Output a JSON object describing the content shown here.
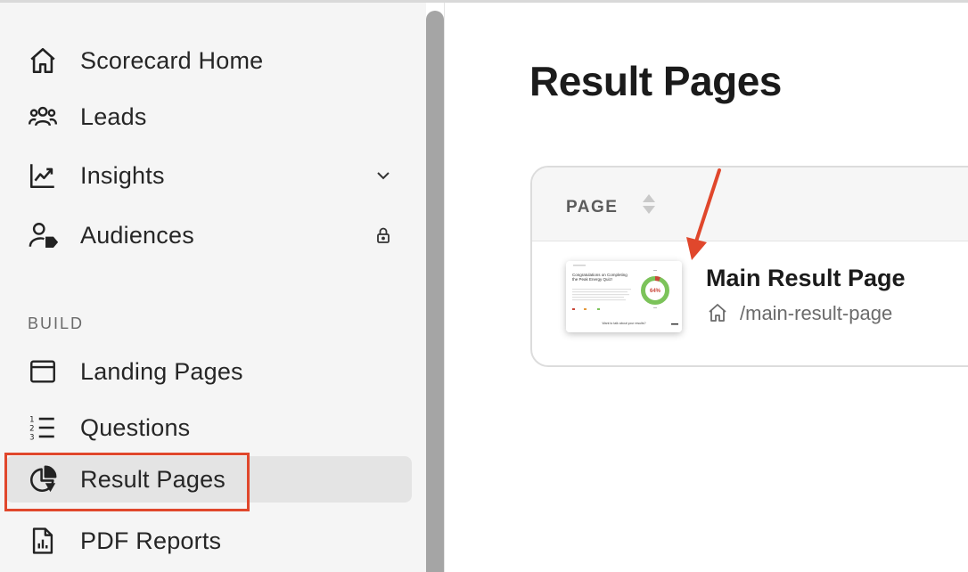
{
  "sidebar": {
    "items": [
      {
        "label": "Scorecard Home",
        "icon": "home-icon"
      },
      {
        "label": "Leads",
        "icon": "users-icon"
      },
      {
        "label": "Insights",
        "icon": "chart-line-icon",
        "trail": "chevron-down-icon"
      },
      {
        "label": "Audiences",
        "icon": "user-tag-icon",
        "trail": "lock-icon"
      }
    ],
    "section_label": "BUILD",
    "build_items": [
      {
        "label": "Landing Pages",
        "icon": "browser-window-icon"
      },
      {
        "label": "Questions",
        "icon": "numbered-list-icon"
      },
      {
        "label": "Result Pages",
        "icon": "pie-chart-icon",
        "active": true
      },
      {
        "label": "PDF Reports",
        "icon": "pdf-report-icon"
      }
    ]
  },
  "main": {
    "title": "Result Pages",
    "table": {
      "column_header": "PAGE",
      "rows": [
        {
          "title": "Main Result Page",
          "path": "/main-result-page",
          "thumb_icon": "result-page-thumbnail",
          "thumb_heading": "Congratulations on Completing the Peak Energy Quiz!",
          "thumb_percent": "64%",
          "thumb_footer": "Want to talk about your results?"
        }
      ]
    }
  },
  "colors": {
    "accent": "#e0472c",
    "donut_green": "#7cc35a",
    "donut_red": "#c9473a"
  }
}
